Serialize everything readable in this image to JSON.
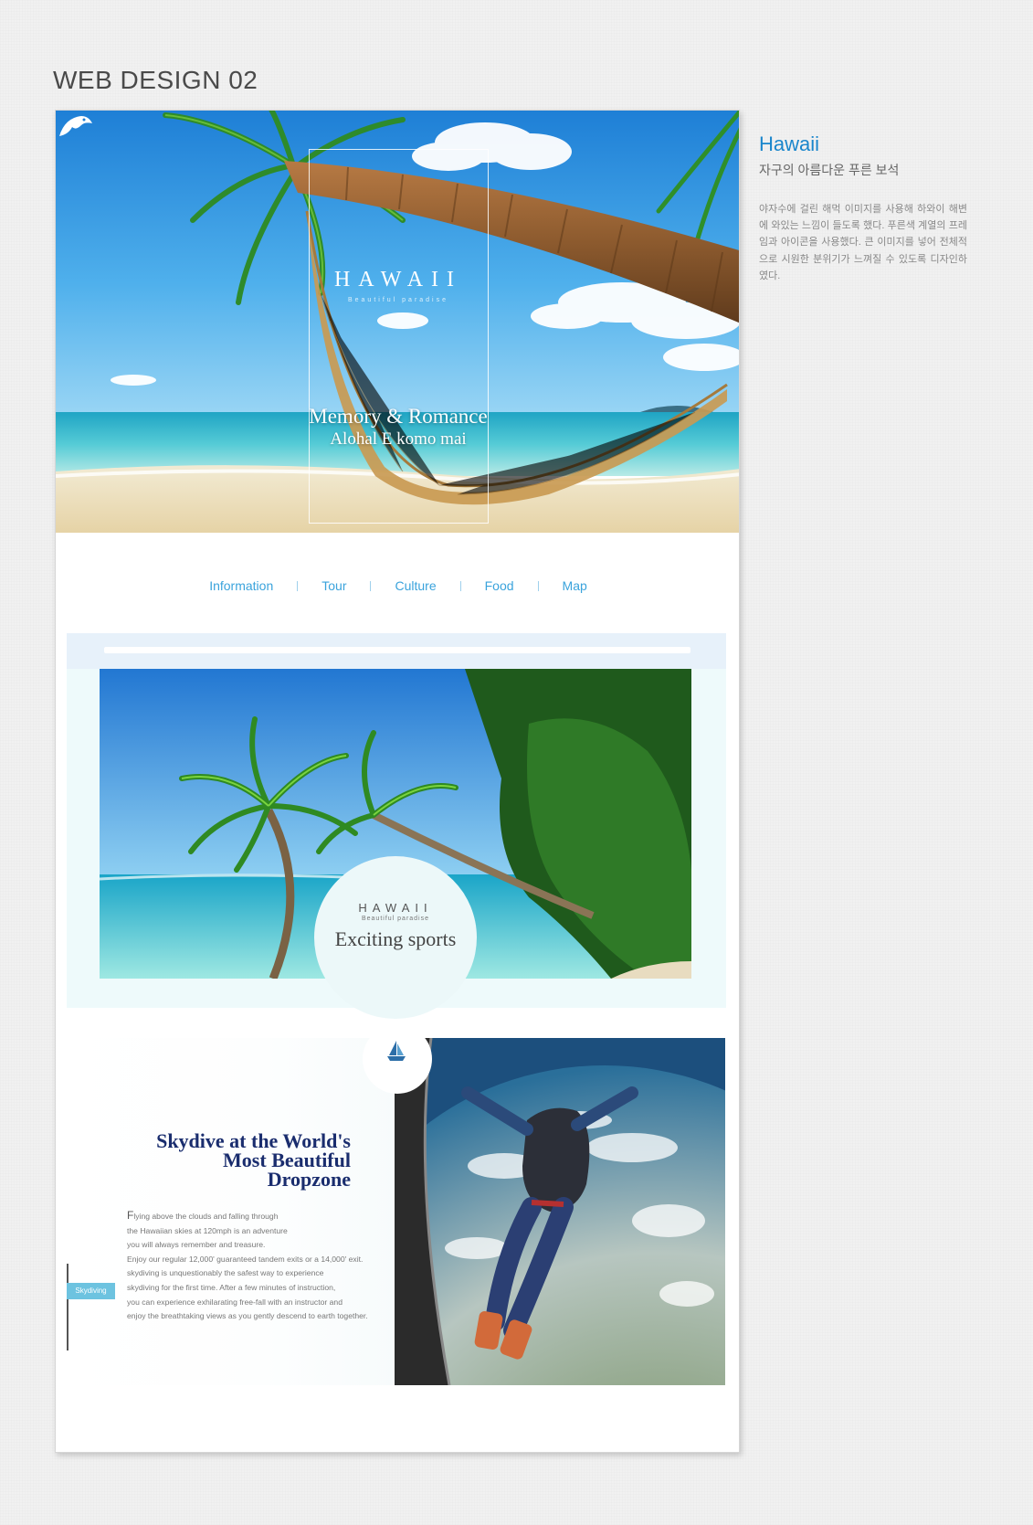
{
  "page": {
    "heading": "WEB DESIGN 02"
  },
  "hero": {
    "brand": "HAWAII",
    "brand_sub": "Beautiful paradise",
    "tagline_1": "Memory & Romance",
    "tagline_2": "Alohal E komo mai",
    "logo_icon": "bird-icon"
  },
  "nav": {
    "items": [
      "Information",
      "Tour",
      "Culture",
      "Food",
      "Map"
    ],
    "color": "#3aa3dc"
  },
  "feature": {
    "brand": "HAWAII",
    "brand_sub": "Beautiful paradise",
    "caption": "Exciting sports"
  },
  "skydive": {
    "heading_lines": [
      "Skydive at the World's",
      "Most Beautiful",
      "Dropzone"
    ],
    "body_first_letter": "F",
    "body_lines": [
      "lying above the clouds and falling through",
      "the Hawaiian skies at 120mph is an adventure",
      "you will always remember and treasure.",
      "Enjoy our regular 12,000' guaranteed tandem exits or a 14,000' exit.",
      "skydiving is unquestionably the safest way to experience",
      "skydiving for the first time. After a few minutes of instruction,",
      "you can experience exhilarating free-fall with an instructor and",
      "enjoy the breathtaking views as you gently descend to earth together."
    ],
    "badge": "Skydiving",
    "boat_icon": "sailboat-icon"
  },
  "description": {
    "title": "Hawaii",
    "subtitle": "자구의 아름다운 푸른 보석",
    "body": "야자수에 걸린 해먹 이미지를 사용해 하와이 해변에 와있는 느낌이 들도록 했다. 푸른색 계열의 프레임과 아이콘을 사용했다. 큰 이미지를 넣어 전체적으로 시원한 분위기가 느껴질 수 있도록 디자인하였다.",
    "title_color": "#1a86cc"
  }
}
